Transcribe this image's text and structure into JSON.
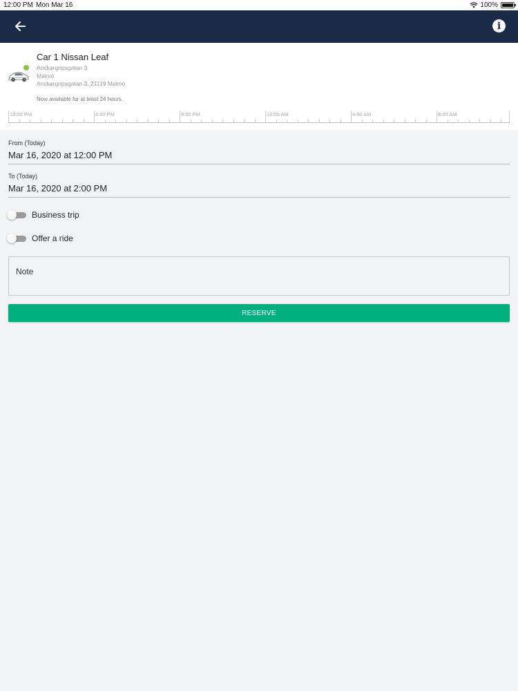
{
  "status_bar": {
    "time": "12:00 PM",
    "date": "Mon Mar 16",
    "battery": "100%",
    "icons": [
      "wifi-icon",
      "battery-icon"
    ]
  },
  "app_bar": {
    "back_icon": "arrow-left-icon",
    "info_icon": "info-icon",
    "info_glyph": "i",
    "background": "#1b2a46"
  },
  "car": {
    "name": "Car 1 Nissan Leaf",
    "address_line1": "Anckargripsgatan 3",
    "city": "Malmö",
    "address_line2": "Anckargripsgatan 3, 21119 Malmö",
    "availability": "Now available for at least 24 hours.",
    "status_color": "#8bc34a"
  },
  "timeline": {
    "labels": [
      "12:00 PM",
      "4:00 PM",
      "8:00 PM",
      "12:00 AM",
      "4:00 AM",
      "8:00 AM"
    ]
  },
  "form": {
    "from_label": "From (Today)",
    "from_value": "Mar 16, 2020 at 12:00 PM",
    "to_label": "To (Today)",
    "to_value": "Mar 16, 2020 at 2:00 PM",
    "business_trip_label": "Business trip",
    "business_trip_on": false,
    "offer_ride_label": "Offer a ride",
    "offer_ride_on": false,
    "note_placeholder": "Note",
    "reserve_label": "RESERVE",
    "reserve_color": "#00b07e"
  }
}
